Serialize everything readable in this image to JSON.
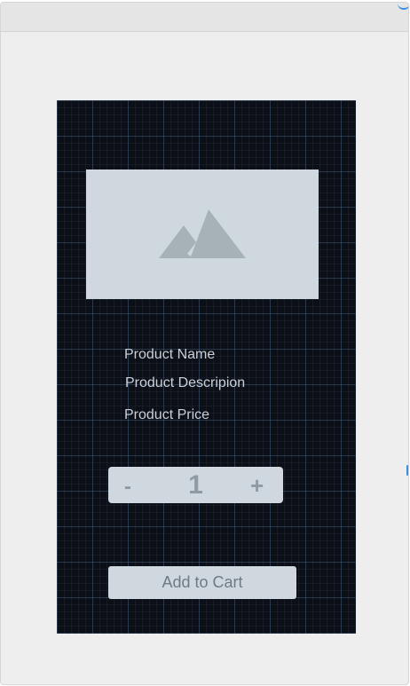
{
  "product": {
    "image_icon": "mountain-image-icon",
    "name": "Product Name",
    "description": "Product Descripion",
    "price": "Product Price"
  },
  "quantity": {
    "decrement_label": "-",
    "value": "1",
    "increment_label": "+"
  },
  "cart": {
    "add_label": "Add to Cart"
  },
  "colors": {
    "canvas_background": "#0c1016",
    "placeholder": "#cfd8de",
    "accent": "#3c8fe0"
  }
}
